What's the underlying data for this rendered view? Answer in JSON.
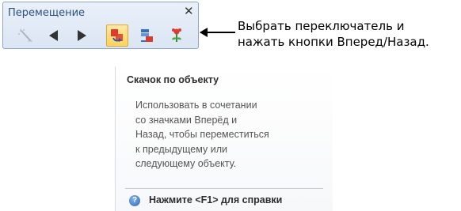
{
  "toolbar": {
    "title": "Перемещение",
    "close_glyph": "✕",
    "buttons": [
      {
        "icon": "magic-wand-icon",
        "state": "disabled"
      },
      {
        "icon": "arrow-left-icon",
        "state": "normal"
      },
      {
        "icon": "arrow-right-icon",
        "state": "normal"
      },
      {
        "icon": "travel-by-object-icon",
        "state": "active"
      },
      {
        "icon": "travel-by-color-icon",
        "state": "normal"
      },
      {
        "icon": "travel-by-flower-icon",
        "state": "normal"
      }
    ]
  },
  "callout": {
    "line1": "Выбрать переключатель и",
    "line2": "нажать кнопки Вперед/Назад."
  },
  "tooltip": {
    "title": "Скачок по объекту",
    "body_lines": [
      "Использовать в сочетании",
      "со значками Вперёд и",
      "Назад, чтобы переместиться",
      "к предыдущему или",
      "следующему объекту."
    ],
    "help_text": "Нажмите <F1> для справки",
    "help_icon_glyph": "?"
  },
  "colors": {
    "toolbar_border": "#8aa6c9",
    "active_button": "#ffd35b",
    "title_text": "#2b4f86"
  }
}
